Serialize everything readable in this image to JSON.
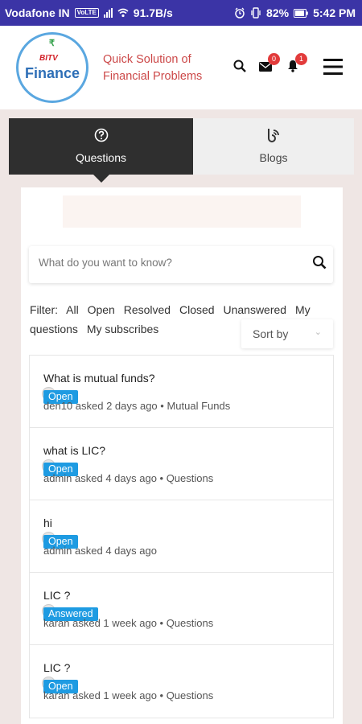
{
  "status_bar": {
    "carrier": "Vodafone IN",
    "volte": "VoLTE",
    "speed": "91.7B/s",
    "battery": "82%",
    "time": "5:42 PM"
  },
  "header": {
    "logo_top": "BITV",
    "logo_main": "Finance",
    "tagline_line1": "Quick Solution of",
    "tagline_line2": "Financial Problems",
    "mail_count": "0",
    "notification_count": "1"
  },
  "tabs": [
    {
      "label": "Questions",
      "active": true
    },
    {
      "label": "Blogs",
      "active": false
    }
  ],
  "search": {
    "placeholder": "What do you want to know?"
  },
  "filters": {
    "label": "Filter:",
    "options": [
      "All",
      "Open",
      "Resolved",
      "Closed",
      "Unanswered",
      "My questions",
      "My subscribes"
    ]
  },
  "sort": {
    "label": "Sort by"
  },
  "questions": [
    {
      "title": "What is mutual funds?",
      "status": "Open",
      "meta": "den10 asked 2 days ago • Mutual Funds"
    },
    {
      "title": "what is LIC?",
      "status": "Open",
      "meta": "admin asked 4 days ago • Questions"
    },
    {
      "title": "hi",
      "status": "Open",
      "meta": "admin asked 4 days ago"
    },
    {
      "title": "LIC ?",
      "status": "Answered",
      "meta": "karan asked 1 week ago • Questions"
    },
    {
      "title": "LIC ?",
      "status": "Open",
      "meta": "karan asked 1 week ago • Questions"
    }
  ],
  "colors": {
    "status_bar": "#3b34a6",
    "tagline": "#cc4848",
    "status_badge": "#1e9be2",
    "active_tab": "#2f2f2f",
    "badge": "#e23b3b"
  }
}
